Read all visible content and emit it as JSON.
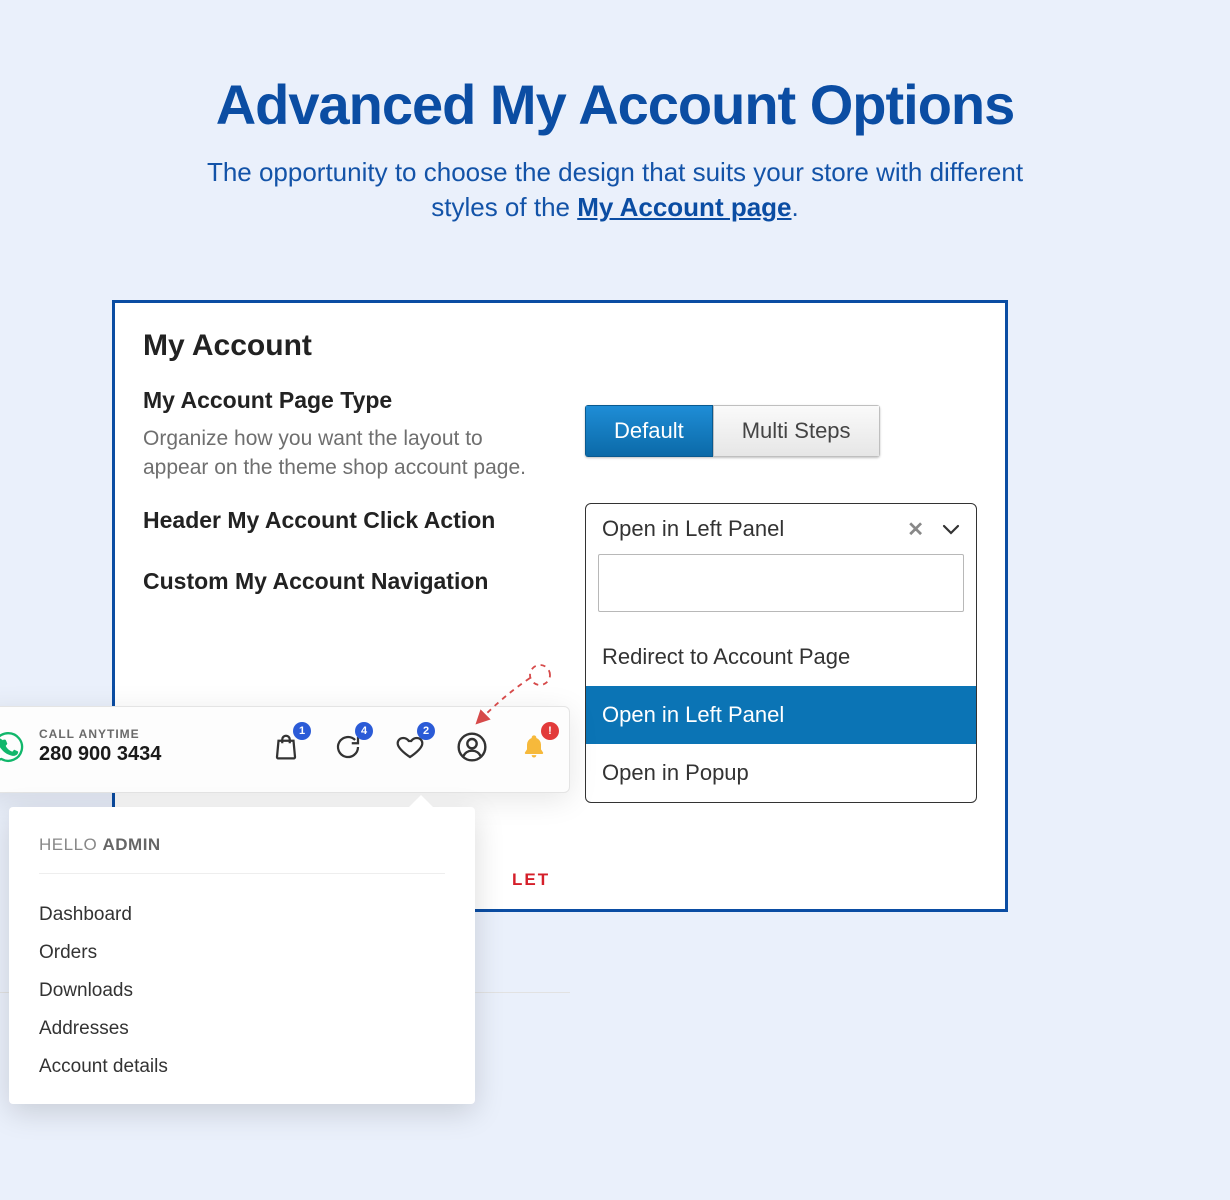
{
  "hero": {
    "title": "Advanced My Account Options",
    "sub_before": "The opportunity to choose the design that suits your store with different styles of the ",
    "sub_link": "My Account page",
    "sub_after": "."
  },
  "settings": {
    "title": "My Account",
    "page_type_label": "My Account Page Type",
    "page_type_desc": "Organize how you want the layout to appear on the theme shop account page.",
    "toggle": {
      "default": "Default",
      "multistep": "Multi Steps",
      "active": "default"
    },
    "header_action_label": "Header My Account Click Action",
    "custom_nav_label": "Custom My Account Navigation",
    "dropdown": {
      "selected": "Open in Left Panel",
      "options": [
        "Redirect to Account Page",
        "Open in Left Panel",
        "Open in Popup"
      ],
      "selected_index": 1
    }
  },
  "shop": {
    "call_label": "CALL ANYTIME",
    "phone": "280 900 3434",
    "badges": {
      "bag": "1",
      "refresh": "4",
      "heart": "2",
      "bell": "!"
    }
  },
  "popup": {
    "hello": "HELLO ",
    "user": "ADMIN",
    "items": [
      "Dashboard",
      "Orders",
      "Downloads",
      "Addresses",
      "Account details"
    ]
  },
  "red_tag": "LET"
}
